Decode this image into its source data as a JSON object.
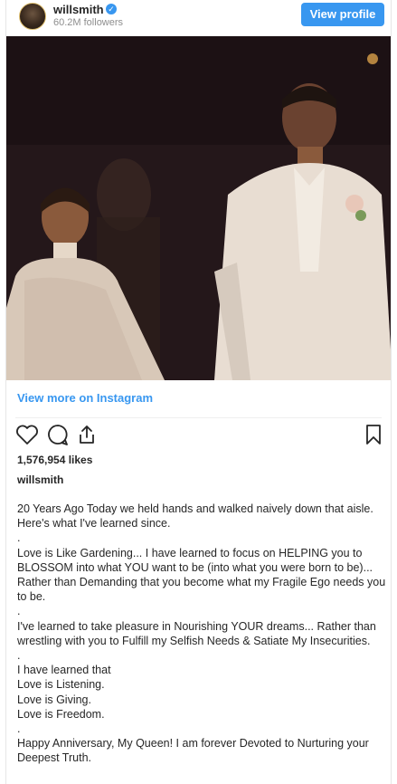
{
  "header": {
    "username": "willsmith",
    "followers": "60.2M followers",
    "view_profile_label": "View profile"
  },
  "post": {
    "view_more_label": "View more on Instagram",
    "likes": "1,576,954 likes",
    "caption_username": "willsmith",
    "caption_lines": [
      "20 Years Ago Today we held hands and walked naively down that aisle. Here's what I've learned since.",
      ".",
      "Love is Like Gardening... I have learned to focus on HELPING you to BLOSSOM into what YOU want to be (into what you were born to be)... Rather than Demanding that you become what my Fragile Ego needs you to be.",
      ".",
      "I've learned to take pleasure in Nourishing YOUR dreams... Rather than wrestling with you to Fulfill my Selfish Needs & Satiate My Insecurities.",
      ".",
      "I have learned that",
      "Love is Listening.",
      "Love is Giving.",
      "Love is Freedom.",
      ".",
      "Happy Anniversary, My Queen! I am forever Devoted to Nurturing your Deepest Truth."
    ]
  },
  "icons": {
    "verified": "verified-badge-icon",
    "like": "heart-icon",
    "comment": "comment-icon",
    "share": "share-icon",
    "save": "bookmark-icon"
  },
  "colors": {
    "accent": "#3897f0",
    "text": "#262626",
    "muted": "#8e8e8e"
  }
}
